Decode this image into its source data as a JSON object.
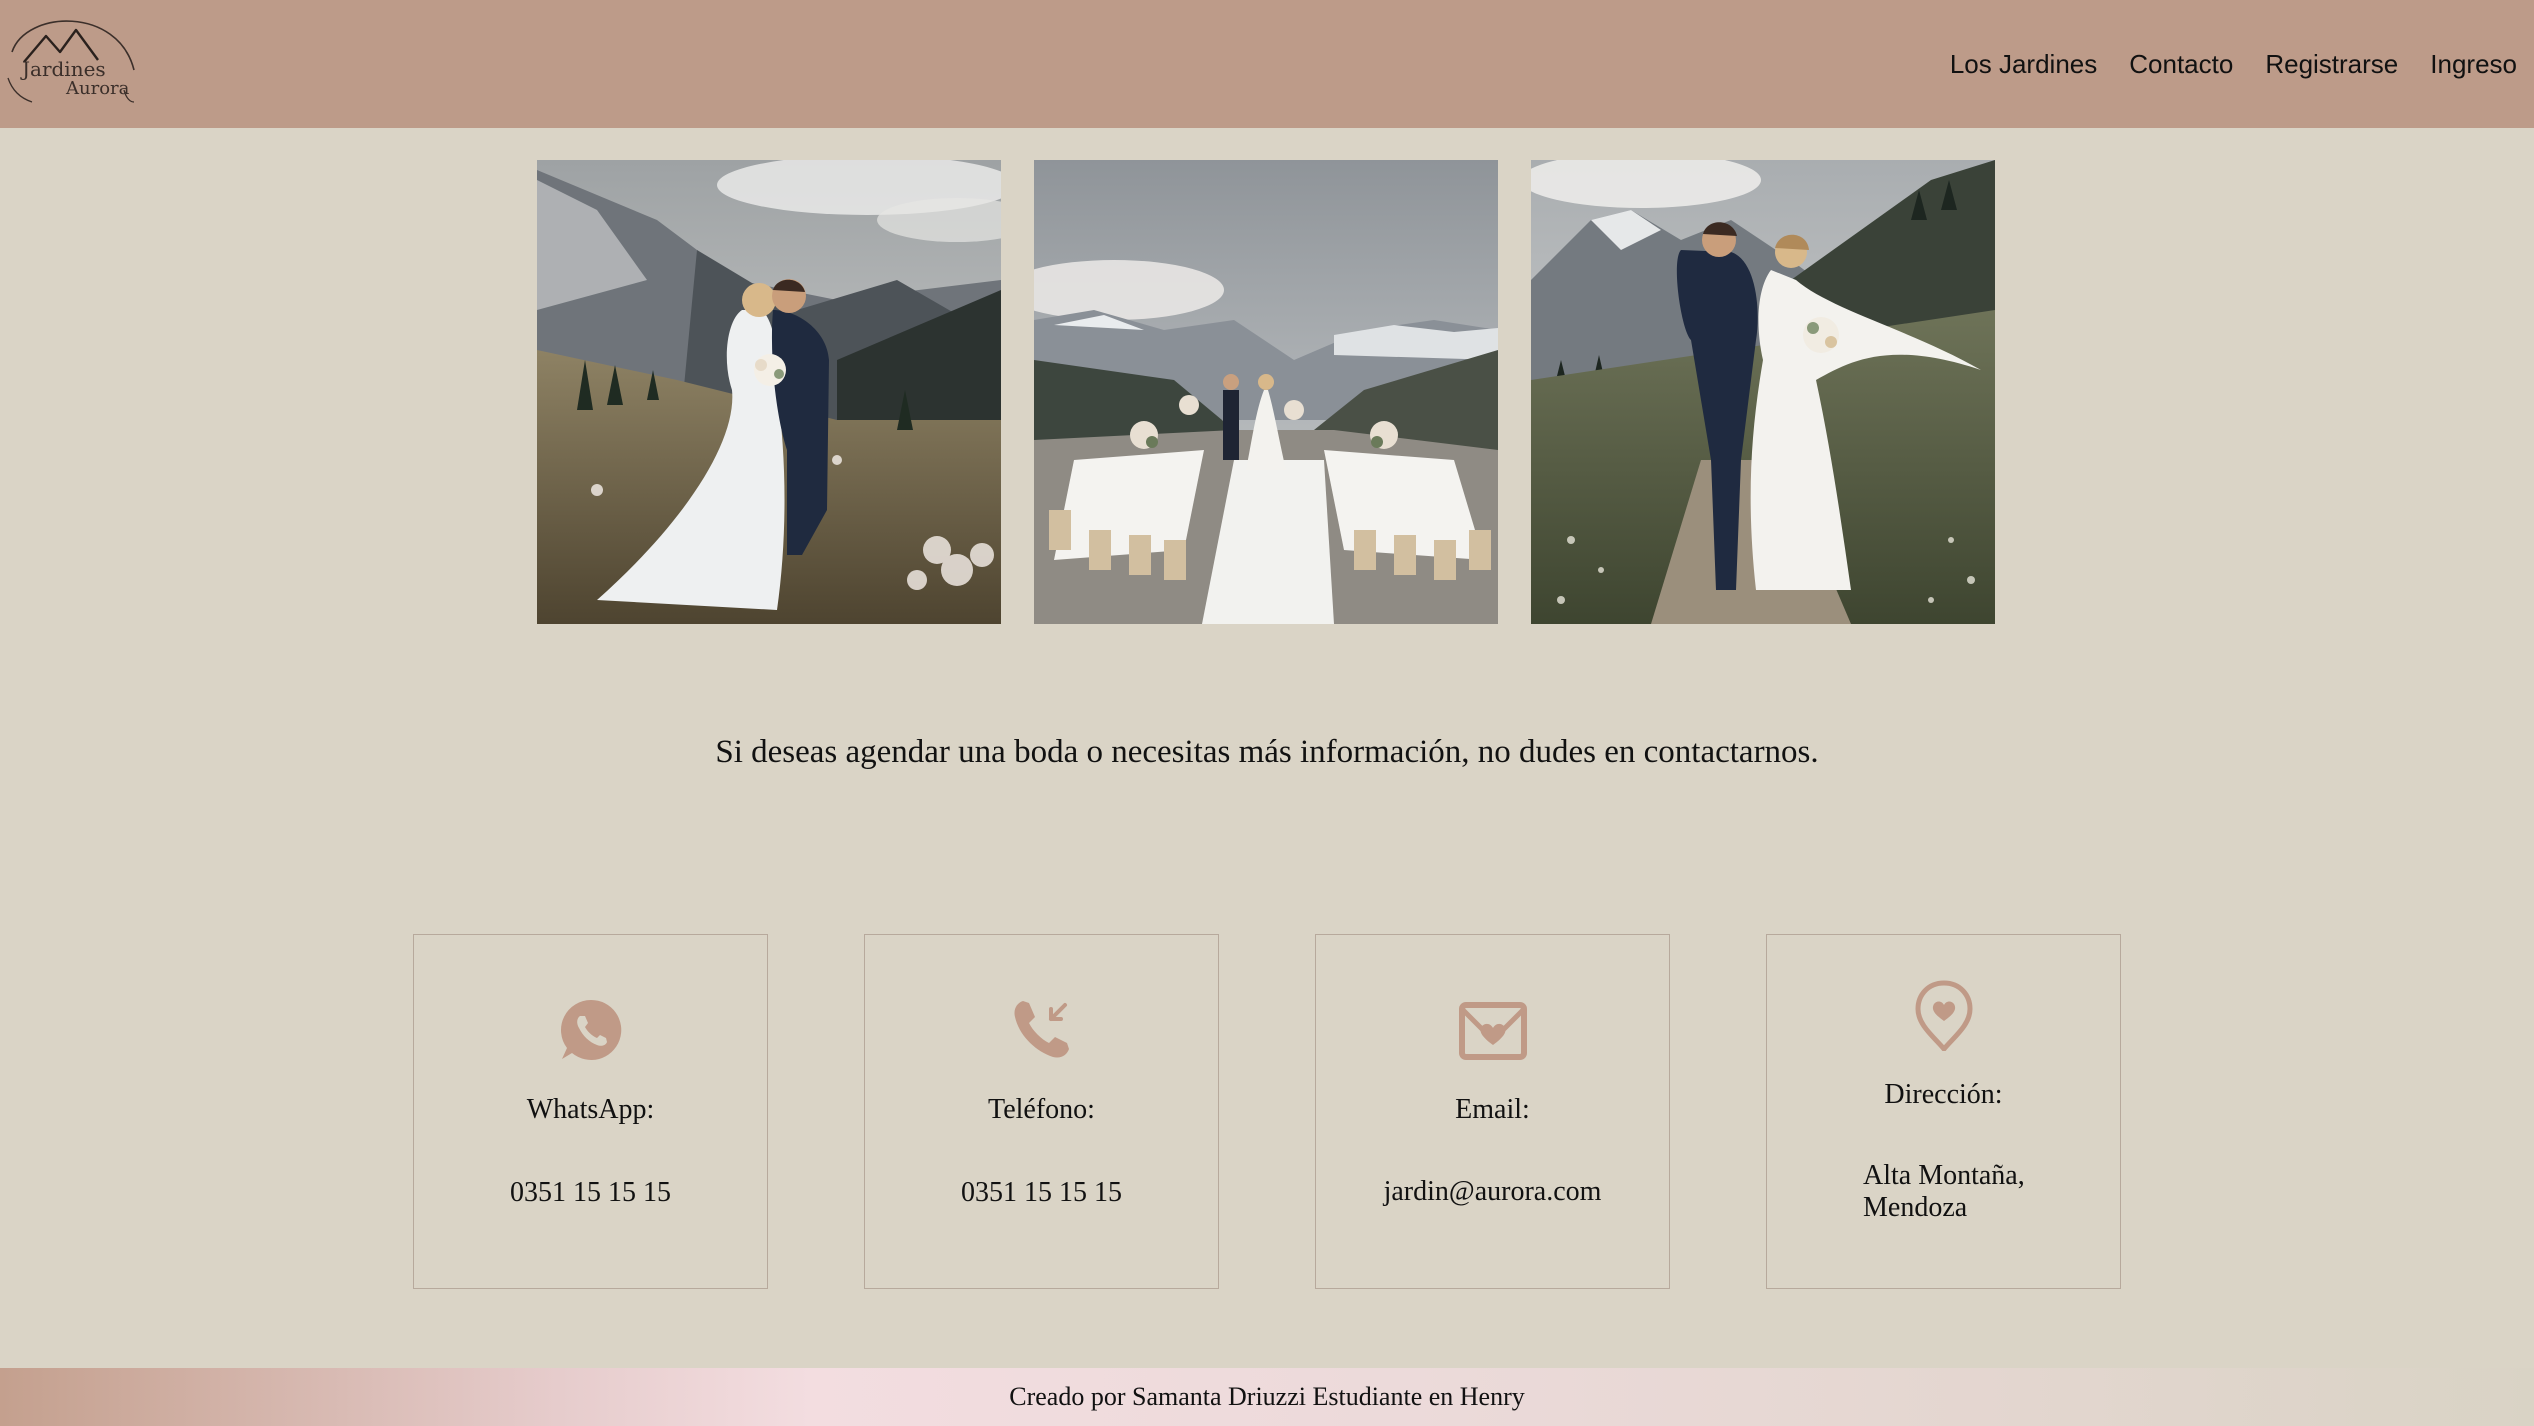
{
  "header": {
    "logo_text_top": "Jardines",
    "logo_text_bottom": "Aurora",
    "nav": [
      {
        "label": "Los Jardines"
      },
      {
        "label": "Contacto"
      },
      {
        "label": "Registrarse"
      },
      {
        "label": "Ingreso"
      }
    ],
    "background_color": "#bd9b89"
  },
  "gallery": {
    "photos": [
      {
        "icon": "couple-mountain-meadow-photo"
      },
      {
        "icon": "outdoor-wedding-tables-photo"
      },
      {
        "icon": "couple-walking-path-photo"
      }
    ]
  },
  "main": {
    "message": "Si deseas agendar una boda o necesitas más información, no dudes en contactarnos."
  },
  "contact": {
    "accent_color": "#c09a87",
    "cards": [
      {
        "icon": "whatsapp-icon",
        "label": "WhatsApp:",
        "value": "0351 15 15 15"
      },
      {
        "icon": "phone-incoming-icon",
        "label": "Teléfono:",
        "value": "0351 15 15 15"
      },
      {
        "icon": "mail-heart-icon",
        "label": "Email:",
        "value": "jardin@aurora.com"
      },
      {
        "icon": "location-heart-icon",
        "label": "Dirección:",
        "value_line1": "Alta Montaña,",
        "value_line2": "Mendoza"
      }
    ]
  },
  "footer": {
    "text": "Creado por Samanta Driuzzi Estudiante en Henry"
  }
}
